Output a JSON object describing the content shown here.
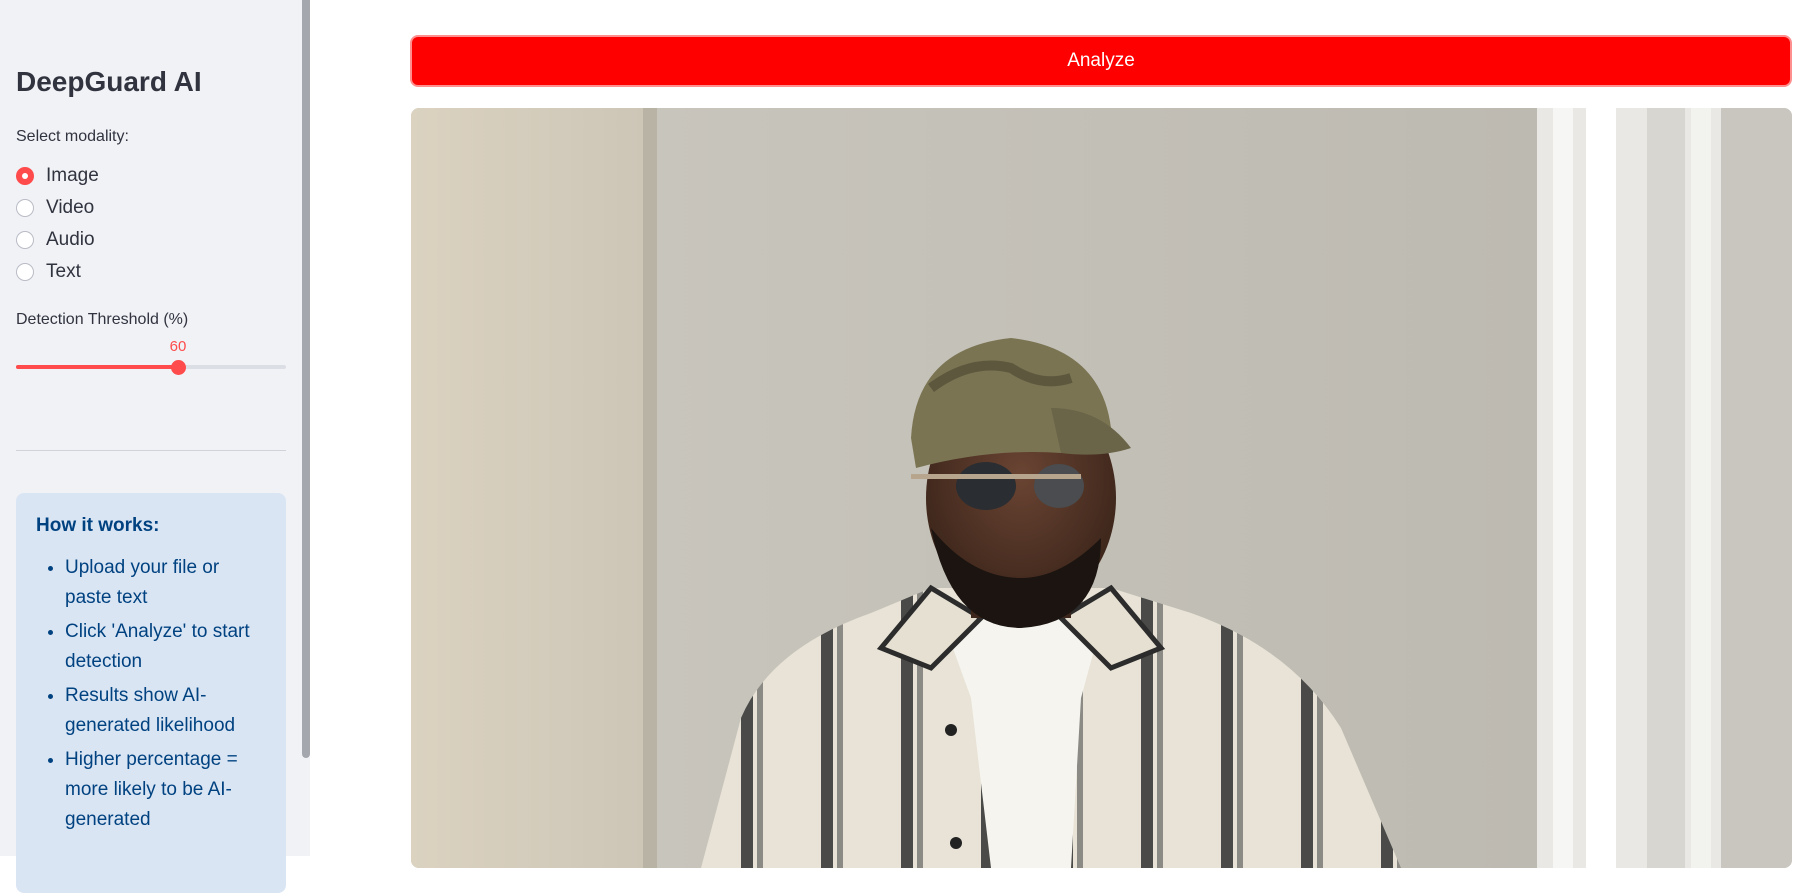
{
  "sidebar": {
    "title": "DeepGuard AI",
    "modality_label": "Select modality:",
    "modalities": [
      {
        "label": "Image",
        "selected": true
      },
      {
        "label": "Video",
        "selected": false
      },
      {
        "label": "Audio",
        "selected": false
      },
      {
        "label": "Text",
        "selected": false
      }
    ],
    "threshold": {
      "label": "Detection Threshold (%)",
      "value": 60,
      "min": 0,
      "max": 100,
      "accent": "#ff4b4b"
    },
    "info": {
      "title": "How it works:",
      "items": [
        "Upload your file or paste text",
        "Click 'Analyze' to start detection",
        "Results show AI-generated likelihood",
        "Higher percentage = more likely to be AI-generated"
      ]
    }
  },
  "main": {
    "analyze_label": "Analyze",
    "analyze_color": "#ff0000",
    "preview_icon": "uploaded-photo-preview"
  }
}
